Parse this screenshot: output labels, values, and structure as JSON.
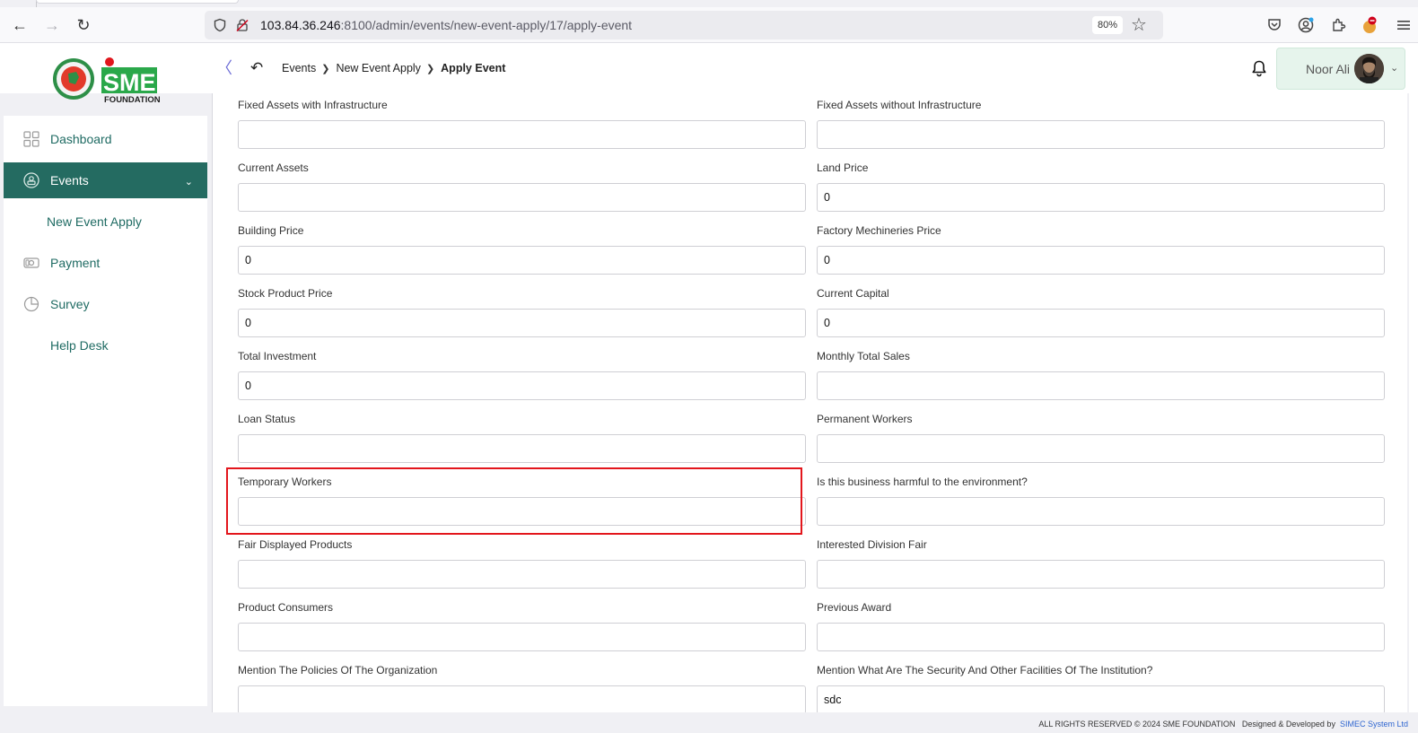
{
  "browser": {
    "url_host": "103.84.36.246",
    "url_path": ":8100/admin/events/new-event-apply/17/apply-event",
    "zoom": "80%"
  },
  "header": {
    "breadcrumb": [
      "Events",
      "New Event Apply",
      "Apply Event"
    ],
    "user_name": "Noor Ali"
  },
  "logo": {
    "text": "SME",
    "subtext": "FOUNDATION"
  },
  "sidebar": {
    "items": [
      {
        "label": "Dashboard",
        "icon": "grid-icon"
      },
      {
        "label": "Events",
        "icon": "events-icon",
        "active": true
      },
      {
        "label": "New Event Apply",
        "sub": true
      },
      {
        "label": "Payment",
        "icon": "payment-icon"
      },
      {
        "label": "Survey",
        "icon": "pie-chart-icon"
      },
      {
        "label": "Help Desk",
        "sub": true
      }
    ]
  },
  "form": {
    "fields": [
      {
        "label": "Fixed Assets with Infrastructure",
        "value": ""
      },
      {
        "label": "Fixed Assets without Infrastructure",
        "value": ""
      },
      {
        "label": "Current Assets",
        "value": ""
      },
      {
        "label": "Land Price",
        "value": "0"
      },
      {
        "label": "Building Price",
        "value": "0"
      },
      {
        "label": "Factory Mechineries Price",
        "value": "0"
      },
      {
        "label": "Stock Product Price",
        "value": "0"
      },
      {
        "label": "Current Capital",
        "value": "0"
      },
      {
        "label": "Total Investment",
        "value": "0"
      },
      {
        "label": "Monthly Total Sales",
        "value": ""
      },
      {
        "label": "Loan Status",
        "value": ""
      },
      {
        "label": "Permanent Workers",
        "value": ""
      },
      {
        "label": "Temporary Workers",
        "value": ""
      },
      {
        "label": "Is this business harmful to the environment?",
        "value": ""
      },
      {
        "label": "Fair Displayed Products",
        "value": ""
      },
      {
        "label": "Interested Division Fair",
        "value": ""
      },
      {
        "label": "Product Consumers",
        "value": ""
      },
      {
        "label": "Previous Award",
        "value": ""
      },
      {
        "label": "Mention The Policies Of The Organization",
        "value": ""
      },
      {
        "label": "Mention What Are The Security And Other Facilities Of The Institution?",
        "value": "sdc"
      }
    ]
  },
  "footer": {
    "copyright": "ALL RIGHTS RESERVED © 2024 SME FOUNDATION",
    "designed_by": "Designed & Developed by",
    "developer": "SIMEC System Ltd"
  },
  "colors": {
    "primary": "#246b61",
    "highlight": "#e3161c",
    "link": "#2f66d0"
  }
}
